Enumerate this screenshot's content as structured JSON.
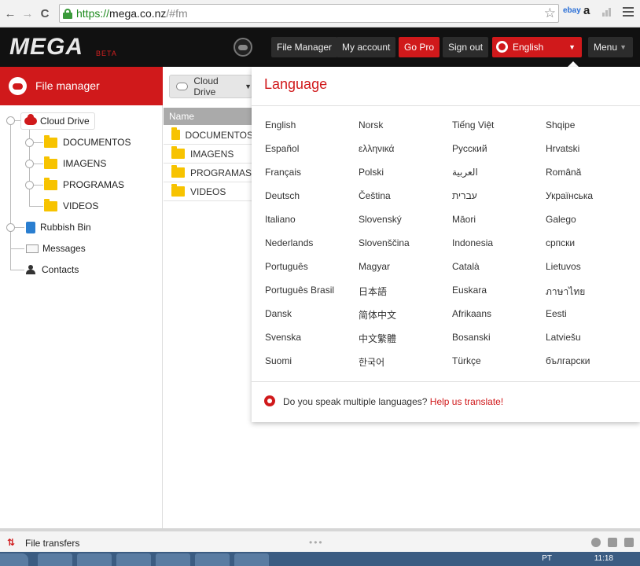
{
  "browser": {
    "url_scheme": "https://",
    "url_host": "mega.co.nz",
    "url_path": "/#fm",
    "ext_ebay": "ebay",
    "ext_amazon": "a"
  },
  "header": {
    "logo": "MEGA",
    "beta": "BETA",
    "file_manager": "File Manager",
    "my_account": "My account",
    "go_pro": "Go Pro",
    "sign_out": "Sign out",
    "language": "English",
    "menu": "Menu",
    "accent_color": "#d0191b"
  },
  "sidebar": {
    "title": "File manager",
    "tree": {
      "cloud_drive": "Cloud Drive",
      "folders": [
        "DOCUMENTOS",
        "IMAGENS",
        "PROGRAMAS",
        "VIDEOS"
      ],
      "rubbish_bin": "Rubbish Bin",
      "messages": "Messages",
      "contacts": "Contacts"
    }
  },
  "main": {
    "breadcrumb": "Cloud Drive",
    "column_name": "Name",
    "files": [
      "DOCUMENTOS",
      "IMAGENS",
      "PROGRAMAS",
      "VIDEOS"
    ]
  },
  "language_panel": {
    "title": "Language",
    "columns": [
      [
        "English",
        "Español",
        "Français",
        "Deutsch",
        "Italiano",
        "Nederlands",
        "Português",
        "Português Brasil",
        "Dansk",
        "Svenska",
        "Suomi"
      ],
      [
        "Norsk",
        "ελληνικά",
        "Polski",
        "Čeština",
        "Slovenský",
        "Slovenščina",
        "Magyar",
        "日本語",
        "简体中文",
        "中文繁體",
        "한국어"
      ],
      [
        "Tiếng Việt",
        "Русский",
        "العربية",
        "עברית",
        "Māori",
        "Indonesia",
        "Català",
        "Euskara",
        "Afrikaans",
        "Bosanski",
        "Türkçe"
      ],
      [
        "Shqipe",
        "Hrvatski",
        "Română",
        "Українська",
        "Galego",
        "српски",
        "Lietuvos",
        "ภาษาไทย",
        "Eesti",
        "Latviešu",
        "български"
      ]
    ],
    "footer_text": "Do you speak multiple languages?",
    "footer_link": "Help us translate!"
  },
  "transfers": {
    "label": "File transfers",
    "dots": "•••"
  },
  "taskbar": {
    "lang": "PT",
    "time": "11:18"
  }
}
